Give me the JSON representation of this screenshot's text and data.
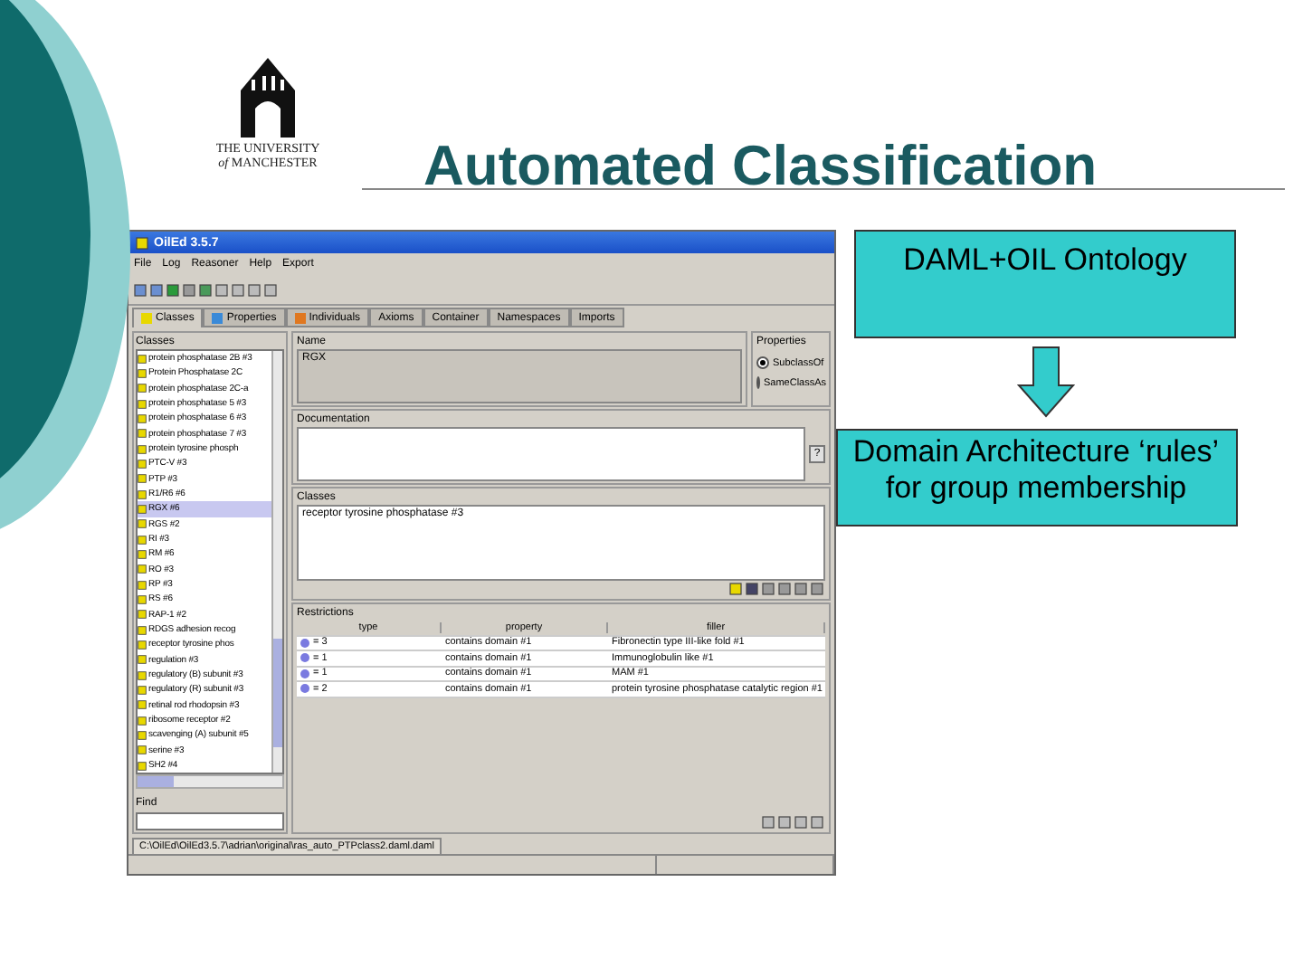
{
  "slide": {
    "title": "Automated Classification",
    "logo_lines": [
      "THE UNIVERSITY",
      "*of* MANCHESTER"
    ],
    "boxes": [
      {
        "text": "DAML+OIL Ontology"
      },
      {
        "text": "Domain Architecture ‘rules’ for group membership"
      }
    ]
  },
  "window": {
    "title": "OilEd 3.5.7"
  },
  "menu": [
    "File",
    "Log",
    "Reasoner",
    "Help",
    "Export"
  ],
  "tabs": [
    {
      "label": "Classes",
      "selected": true,
      "color": "#e8d800"
    },
    {
      "label": "Properties",
      "selected": false,
      "color": "#3a8ad8"
    },
    {
      "label": "Individuals",
      "selected": false,
      "color": "#e07820"
    },
    {
      "label": "Axioms",
      "selected": false
    },
    {
      "label": "Container",
      "selected": false
    },
    {
      "label": "Namespaces",
      "selected": false
    },
    {
      "label": "Imports",
      "selected": false
    }
  ],
  "class_list": {
    "label": "Classes",
    "items": [
      {
        "name": "protein phosphatase 2B #3",
        "selected": false
      },
      {
        "name": "Protein Phosphatase 2C",
        "selected": false
      },
      {
        "name": "protein phosphatase 2C-a",
        "selected": false
      },
      {
        "name": "protein phosphatase 5 #3",
        "selected": false
      },
      {
        "name": "protein phosphatase 6 #3",
        "selected": false
      },
      {
        "name": "protein phosphatase 7 #3",
        "selected": false
      },
      {
        "name": "protein tyrosine phosph",
        "selected": false
      },
      {
        "name": "PTC-V #3",
        "selected": false
      },
      {
        "name": "PTP #3",
        "selected": false
      },
      {
        "name": "R1/R6 #6",
        "selected": false
      },
      {
        "name": "RGX #6",
        "selected": true
      },
      {
        "name": "RGS #2",
        "selected": false
      },
      {
        "name": "RI #3",
        "selected": false
      },
      {
        "name": "RM #6",
        "selected": false
      },
      {
        "name": "RO #3",
        "selected": false
      },
      {
        "name": "RP #3",
        "selected": false
      },
      {
        "name": "RS #6",
        "selected": false
      },
      {
        "name": "RAP-1 #2",
        "selected": false
      },
      {
        "name": "RDGS adhesion recog",
        "selected": false
      },
      {
        "name": "receptor tyrosine phos",
        "selected": false
      },
      {
        "name": "regulation #3",
        "selected": false
      },
      {
        "name": "regulatory (B) subunit #3",
        "selected": false
      },
      {
        "name": "regulatory (R) subunit #3",
        "selected": false
      },
      {
        "name": "retinal rod rhodopsin #3",
        "selected": false
      },
      {
        "name": "ribosome receptor #2",
        "selected": false
      },
      {
        "name": "scavenging (A) subunit #5",
        "selected": false
      },
      {
        "name": "serine #3",
        "selected": false
      },
      {
        "name": "SH2 #4",
        "selected": false
      }
    ]
  },
  "find": {
    "label": "Find"
  },
  "name_panel": {
    "label": "Name",
    "value": "RGX"
  },
  "properties": {
    "label": "Properties",
    "options": [
      {
        "label": "SubclassOf",
        "selected": true
      },
      {
        "label": "SameClassAs",
        "selected": false
      }
    ]
  },
  "documentation": {
    "label": "Documentation",
    "help": "?"
  },
  "superclasses": {
    "label": "Classes",
    "items": [
      "receptor tyrosine phosphatase #3"
    ]
  },
  "restrictions": {
    "label": "Restrictions",
    "columns": [
      "type",
      "property",
      "filler"
    ],
    "rows": [
      {
        "type": "= 3",
        "property": "contains domain #1",
        "filler": "Fibronectin type III-like fold #1"
      },
      {
        "type": "= 1",
        "property": "contains domain #1",
        "filler": "Immunoglobulin like #1"
      },
      {
        "type": "= 1",
        "property": "contains domain #1",
        "filler": "MAM #1"
      },
      {
        "type": "= 2",
        "property": "contains domain #1",
        "filler": "protein tyrosine phosphatase catalytic region #1"
      }
    ]
  },
  "file_tab": "C:\\OilEd\\OilEd3.5.7\\adrian\\original\\ras_auto_PTPclass2.daml.daml"
}
